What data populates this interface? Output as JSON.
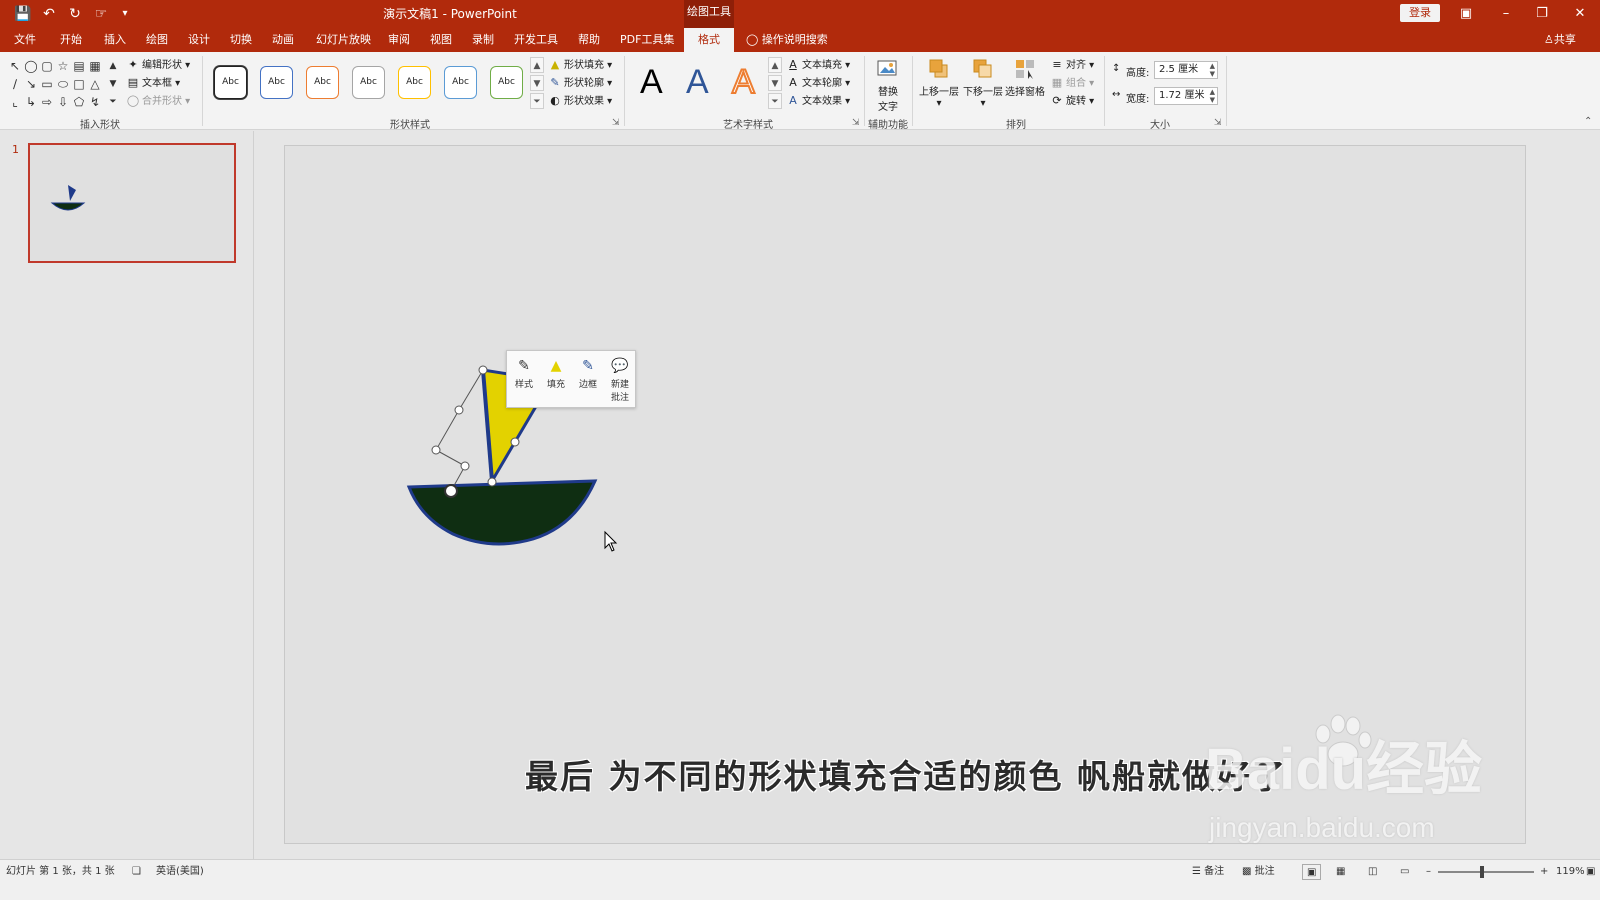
{
  "titlebar": {
    "doc_title": "演示文稿1 - PowerPoint",
    "context_tab": "绘图工具",
    "login": "登录",
    "quick_access": [
      "save-icon",
      "undo-icon",
      "redo-icon",
      "touch-mode-icon",
      "customize-icon"
    ]
  },
  "menu": {
    "items": [
      "文件",
      "开始",
      "插入",
      "绘图",
      "设计",
      "切换",
      "动画",
      "幻灯片放映",
      "审阅",
      "视图",
      "录制",
      "开发工具",
      "帮助",
      "PDF工具集"
    ],
    "active": "格式",
    "tell_me": "操作说明搜索",
    "share": "共享"
  },
  "ribbon": {
    "insert_shapes": {
      "label": "插入形状",
      "edit_shape": "编辑形状",
      "text_box": "文本框",
      "merge_shapes": "合并形状"
    },
    "shape_styles": {
      "label": "形状样式",
      "thumb_text": "Abc",
      "colors": [
        "#222222",
        "#4472c4",
        "#ed7d31",
        "#a5a5a5",
        "#ffc000",
        "#5b9bd5",
        "#70ad47"
      ],
      "fill": "形状填充",
      "outline": "形状轮廓",
      "effects": "形状效果"
    },
    "wordart": {
      "label": "艺术字样式",
      "letter": "A",
      "colors": [
        "#000000",
        "#2f5597",
        "#ed7d31"
      ],
      "text_fill": "文本填充",
      "text_outline": "文本轮廓",
      "text_effects": "文本效果"
    },
    "accessibility": {
      "label": "辅助功能",
      "alt_text_line1": "替换",
      "alt_text_line2": "文字"
    },
    "arrange": {
      "label": "排列",
      "bring_forward": "上移一层",
      "send_backward": "下移一层",
      "selection_pane": "选择窗格",
      "align": "对齐",
      "group": "组合",
      "rotate": "旋转"
    },
    "size": {
      "label": "大小",
      "height_label": "高度:",
      "height_value": "2.5 厘米",
      "width_label": "宽度:",
      "width_value": "1.72 厘米"
    }
  },
  "slides_panel": {
    "slide_number": "1"
  },
  "slide": {
    "caption": "最后 为不同的形状填充合适的颜色 帆船就做好了",
    "boat": {
      "hull_color": "#0f2e12",
      "hull_outline": "#1f3a8a",
      "sail_color": "#e3d200",
      "mast_color": "#1f3a8a"
    },
    "watermark_main": "Baidu经验",
    "watermark_sub": "jingyan.baidu.com"
  },
  "mini_toolbar": {
    "style": "样式",
    "fill": "填充",
    "outline": "边框",
    "new_comment_1": "新建",
    "new_comment_2": "批注"
  },
  "statusbar": {
    "slide_info": "幻灯片 第 1 张，共 1 张",
    "language": "英语(美国)",
    "notes": "备注",
    "comments": "批注",
    "zoom": "119%"
  }
}
